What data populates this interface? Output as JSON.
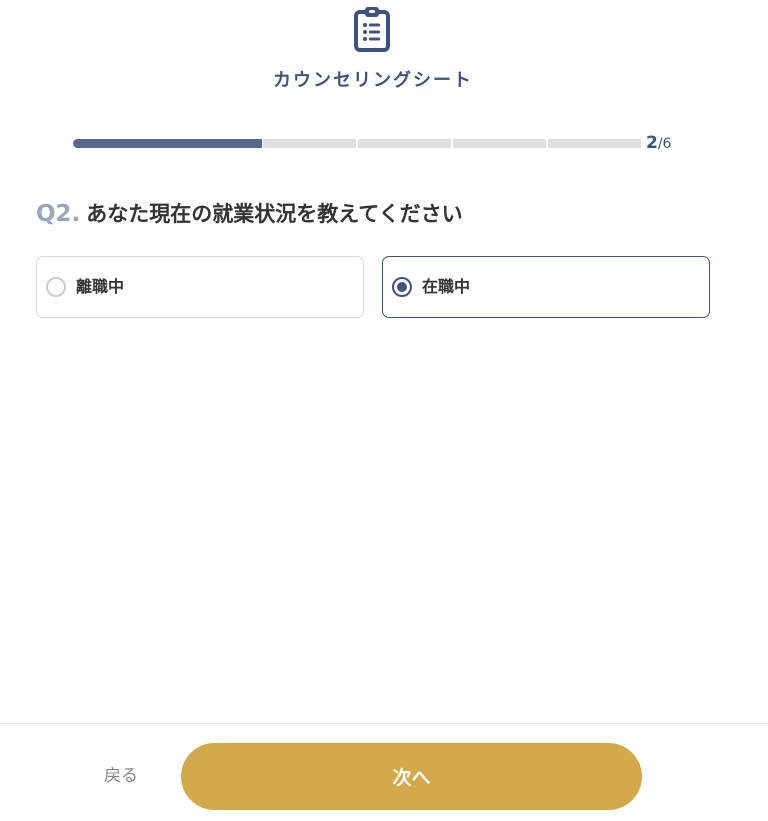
{
  "header": {
    "icon": "clipboard-list-icon",
    "title": "カウンセリングシート"
  },
  "progress": {
    "current": "2",
    "total": "/6",
    "fraction_complete": 0.333
  },
  "question": {
    "number": "Q2.",
    "text": "あなた現在の就業状況を教えてください"
  },
  "options": [
    {
      "label": "離職中",
      "selected": false
    },
    {
      "label": "在職中",
      "selected": true
    }
  ],
  "footer": {
    "back_label": "戻る",
    "next_label": "次へ"
  },
  "colors": {
    "brand_navy": "#3f5383",
    "progress_fill": "#56698f",
    "progress_track": "#e0e0e0",
    "question_number": "#9aa6bf",
    "next_button": "#d4a94c",
    "option_border": "#dcdcdc"
  }
}
